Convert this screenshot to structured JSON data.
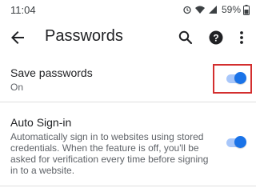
{
  "status_bar": {
    "time": "11:04",
    "battery": "59%",
    "icons": [
      "alarm-icon",
      "wifi-icon",
      "signal-icon",
      "battery-icon"
    ]
  },
  "app_bar": {
    "title": "Passwords",
    "icons": [
      "back-arrow-icon",
      "search-icon",
      "help-icon",
      "more-vert-icon"
    ]
  },
  "settings": {
    "save_passwords": {
      "title": "Save passwords",
      "status": "On",
      "enabled": true
    },
    "auto_sign_in": {
      "title": "Auto Sign-in",
      "description": "Automatically sign in to websites using stored credentials. When the feature is off, you'll be asked for verification every time before signing in to a website.",
      "enabled": true
    }
  },
  "colors": {
    "accent": "#1a73e8",
    "toggle_track": "#a8c7fa",
    "highlight_box": "#d32f2f"
  }
}
